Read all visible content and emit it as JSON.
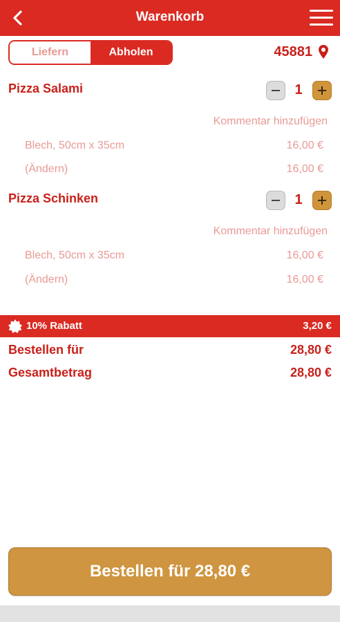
{
  "header": {
    "title": "Warenkorb",
    "back_icon": "chevron-left-icon",
    "menu_icon": "hamburger-menu-icon"
  },
  "delivery_toggle": {
    "options": [
      "Liefern",
      "Abholen"
    ],
    "selected": "Abholen"
  },
  "location": {
    "zip": "45881",
    "icon": "location-pin-icon"
  },
  "cart": {
    "items": [
      {
        "name": "Pizza Salami",
        "quantity": "1",
        "comment_link": "Kommentar hinzufügen",
        "options": [
          {
            "label": "Blech, 50cm x 35cm",
            "price": "16,00 €"
          },
          {
            "label": "(Ändern)",
            "price": "16,00 €"
          }
        ]
      },
      {
        "name": "Pizza Schinken",
        "quantity": "1",
        "comment_link": "Kommentar hinzufügen",
        "options": [
          {
            "label": "Blech, 50cm x 35cm",
            "price": "16,00 €"
          },
          {
            "label": "(Ändern)",
            "price": "16,00 €"
          }
        ]
      }
    ]
  },
  "discount": {
    "label": "10% Rabatt",
    "amount": "3,20 €",
    "icon": "badge-star-icon"
  },
  "totals": {
    "order_for_label": "Bestellen für",
    "order_for_value": "28,80 €",
    "grand_total_label": "Gesamtbetrag",
    "grand_total_value": "28,80 €"
  },
  "order_button": {
    "label": "Bestellen für 28,80 €"
  },
  "colors": {
    "brand_red": "#da2a22",
    "text_red": "#c8211b",
    "muted_pink": "#e89a95",
    "button_gold": "#cf9540"
  }
}
